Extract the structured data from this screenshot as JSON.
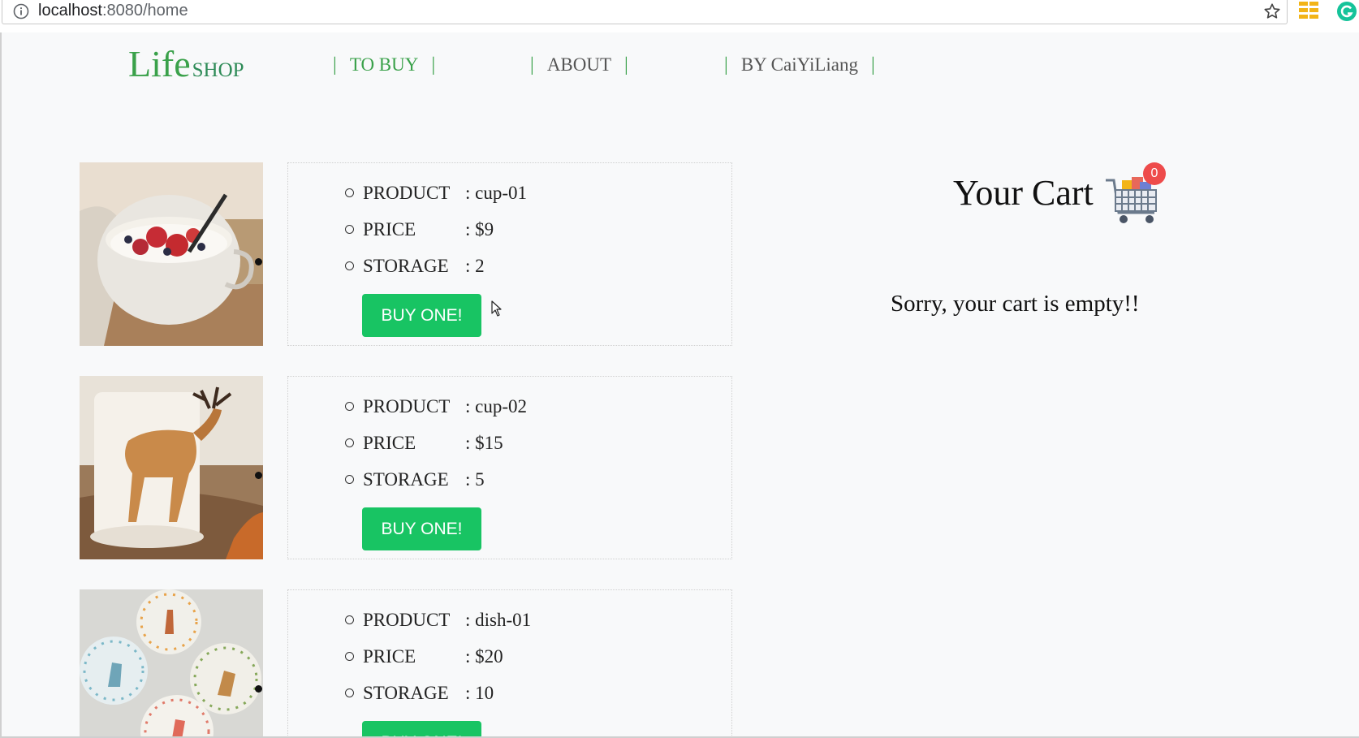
{
  "browser": {
    "url_host": "localhost",
    "url_rest": ":8080/home"
  },
  "header": {
    "logo_main": "Life",
    "logo_sub": "SHOP",
    "nav": [
      {
        "label": "TO BUY",
        "active": true
      },
      {
        "label": "ABOUT",
        "active": false
      },
      {
        "label": "BY CaiYiLiang",
        "active": false
      }
    ]
  },
  "labels": {
    "product": "PRODUCT",
    "price": "PRICE",
    "storage": "STORAGE",
    "buy_button": "BUY ONE!"
  },
  "products": [
    {
      "name": ": cup-01",
      "price": ": $9",
      "storage": ": 2",
      "image": "yogurt-cup-photo"
    },
    {
      "name": ": cup-02",
      "price": ": $15",
      "storage": ": 5",
      "image": "deer-mug-photo"
    },
    {
      "name": ": dish-01",
      "price": ": $20",
      "storage": ": 10",
      "image": "animal-dishes-photo"
    }
  ],
  "cart": {
    "title": "Your Cart",
    "count": "0",
    "empty_message": "Sorry, your cart is empty!!"
  },
  "colors": {
    "brand_green": "#3aa14a",
    "button_green": "#18c463",
    "badge_red": "#ee4b4b"
  }
}
